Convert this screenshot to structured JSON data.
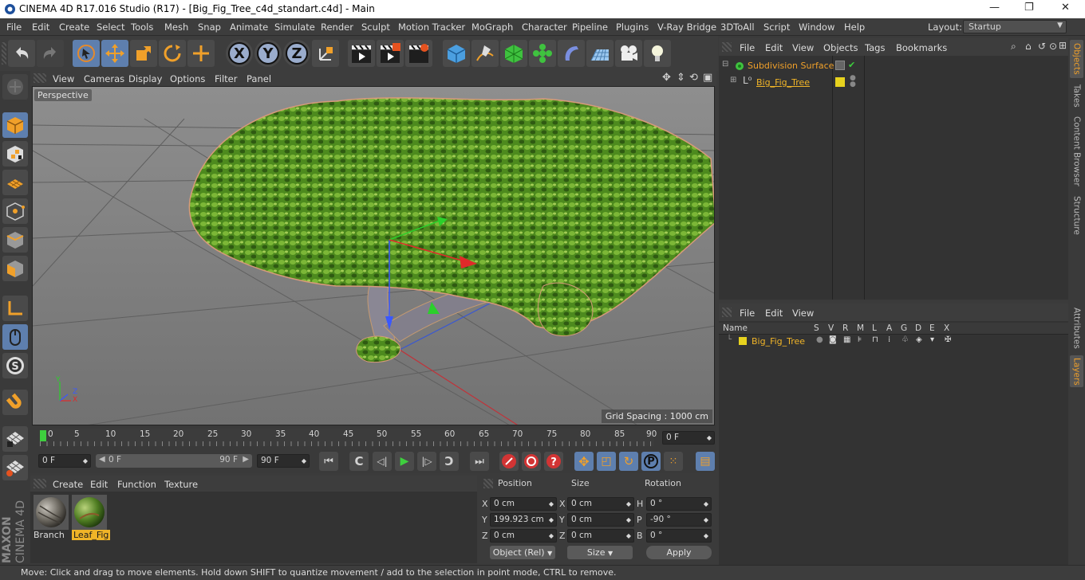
{
  "app": {
    "title": "CINEMA 4D R17.016 Studio (R17) - [Big_Fig_Tree_c4d_standart.c4d] - Main"
  },
  "window_controls": {
    "minimize": "—",
    "maximize": "❐",
    "close": "✕"
  },
  "menubar": {
    "items": [
      "File",
      "Edit",
      "Create",
      "Select",
      "Tools",
      "Mesh",
      "Snap",
      "Animate",
      "Simulate",
      "Render",
      "Sculpt",
      "Motion Tracker",
      "MoGraph",
      "Character",
      "Pipeline",
      "Plugins",
      "V-Ray Bridge",
      "3DToAll",
      "Script",
      "Window",
      "Help"
    ],
    "layout_label": "Layout:",
    "layout_value": "Startup"
  },
  "toolbar": {
    "axis_x": "X",
    "axis_y": "Y",
    "axis_z": "Z"
  },
  "viewport": {
    "menu": [
      "View",
      "Cameras",
      "Display",
      "Options",
      "Filter",
      "Panel"
    ],
    "label": "Perspective",
    "grid_spacing": "Grid Spacing : 1000 cm",
    "axis": {
      "x": "X",
      "y": "Y",
      "z": "Z"
    }
  },
  "timeline": {
    "ticks": [
      "0",
      "5",
      "10",
      "15",
      "20",
      "25",
      "30",
      "35",
      "40",
      "45",
      "50",
      "55",
      "60",
      "65",
      "70",
      "75",
      "80",
      "85",
      "90"
    ],
    "current_frame": "0 F"
  },
  "transport": {
    "start": "0 F",
    "range_start": "0 F",
    "range_end": "90 F",
    "end": "90 F"
  },
  "materials": {
    "menu": [
      "Create",
      "Edit",
      "Function",
      "Texture"
    ],
    "items": [
      {
        "name": "Branch"
      },
      {
        "name": "Leaf_Fig"
      }
    ]
  },
  "coords": {
    "headers": {
      "position": "Position",
      "size": "Size",
      "rotation": "Rotation"
    },
    "rows": [
      {
        "axis": "X",
        "pos": "0 cm",
        "size_axis": "X",
        "size": "0 cm",
        "rot_axis": "H",
        "rot": "0 °"
      },
      {
        "axis": "Y",
        "pos": "199.923 cm",
        "size_axis": "Y",
        "size": "0 cm",
        "rot_axis": "P",
        "rot": "-90 °"
      },
      {
        "axis": "Z",
        "pos": "0 cm",
        "size_axis": "Z",
        "size": "0 cm",
        "rot_axis": "B",
        "rot": "0 °"
      }
    ],
    "mode": "Object (Rel)",
    "size_mode": "Size",
    "apply": "Apply"
  },
  "objects": {
    "menu": [
      "File",
      "Edit",
      "View",
      "Objects",
      "Tags",
      "Bookmarks"
    ],
    "tree": [
      {
        "name": "Subdivision Surface"
      },
      {
        "name": "Big_Fig_Tree"
      }
    ]
  },
  "layers": {
    "menu": [
      "File",
      "Edit",
      "View"
    ],
    "columns": [
      "Name",
      "S",
      "V",
      "R",
      "M",
      "L",
      "A",
      "G",
      "D",
      "E",
      "X"
    ],
    "rows": [
      {
        "name": "Big_Fig_Tree"
      }
    ]
  },
  "right_tabs": [
    "Objects",
    "Takes",
    "Content Browser",
    "Structure",
    "Attributes",
    "Layers"
  ],
  "branding": {
    "maxon": "MAXON",
    "product": "CINEMA 4D"
  },
  "statusbar": {
    "text": "Move: Click and drag to move elements. Hold down SHIFT to quantize movement / add to the selection in point mode, CTRL to remove."
  },
  "colors": {
    "accent": "#5e7fae",
    "highlight": "#f0b428",
    "layer_yellow": "#e7d21e",
    "bg": "#333333"
  }
}
